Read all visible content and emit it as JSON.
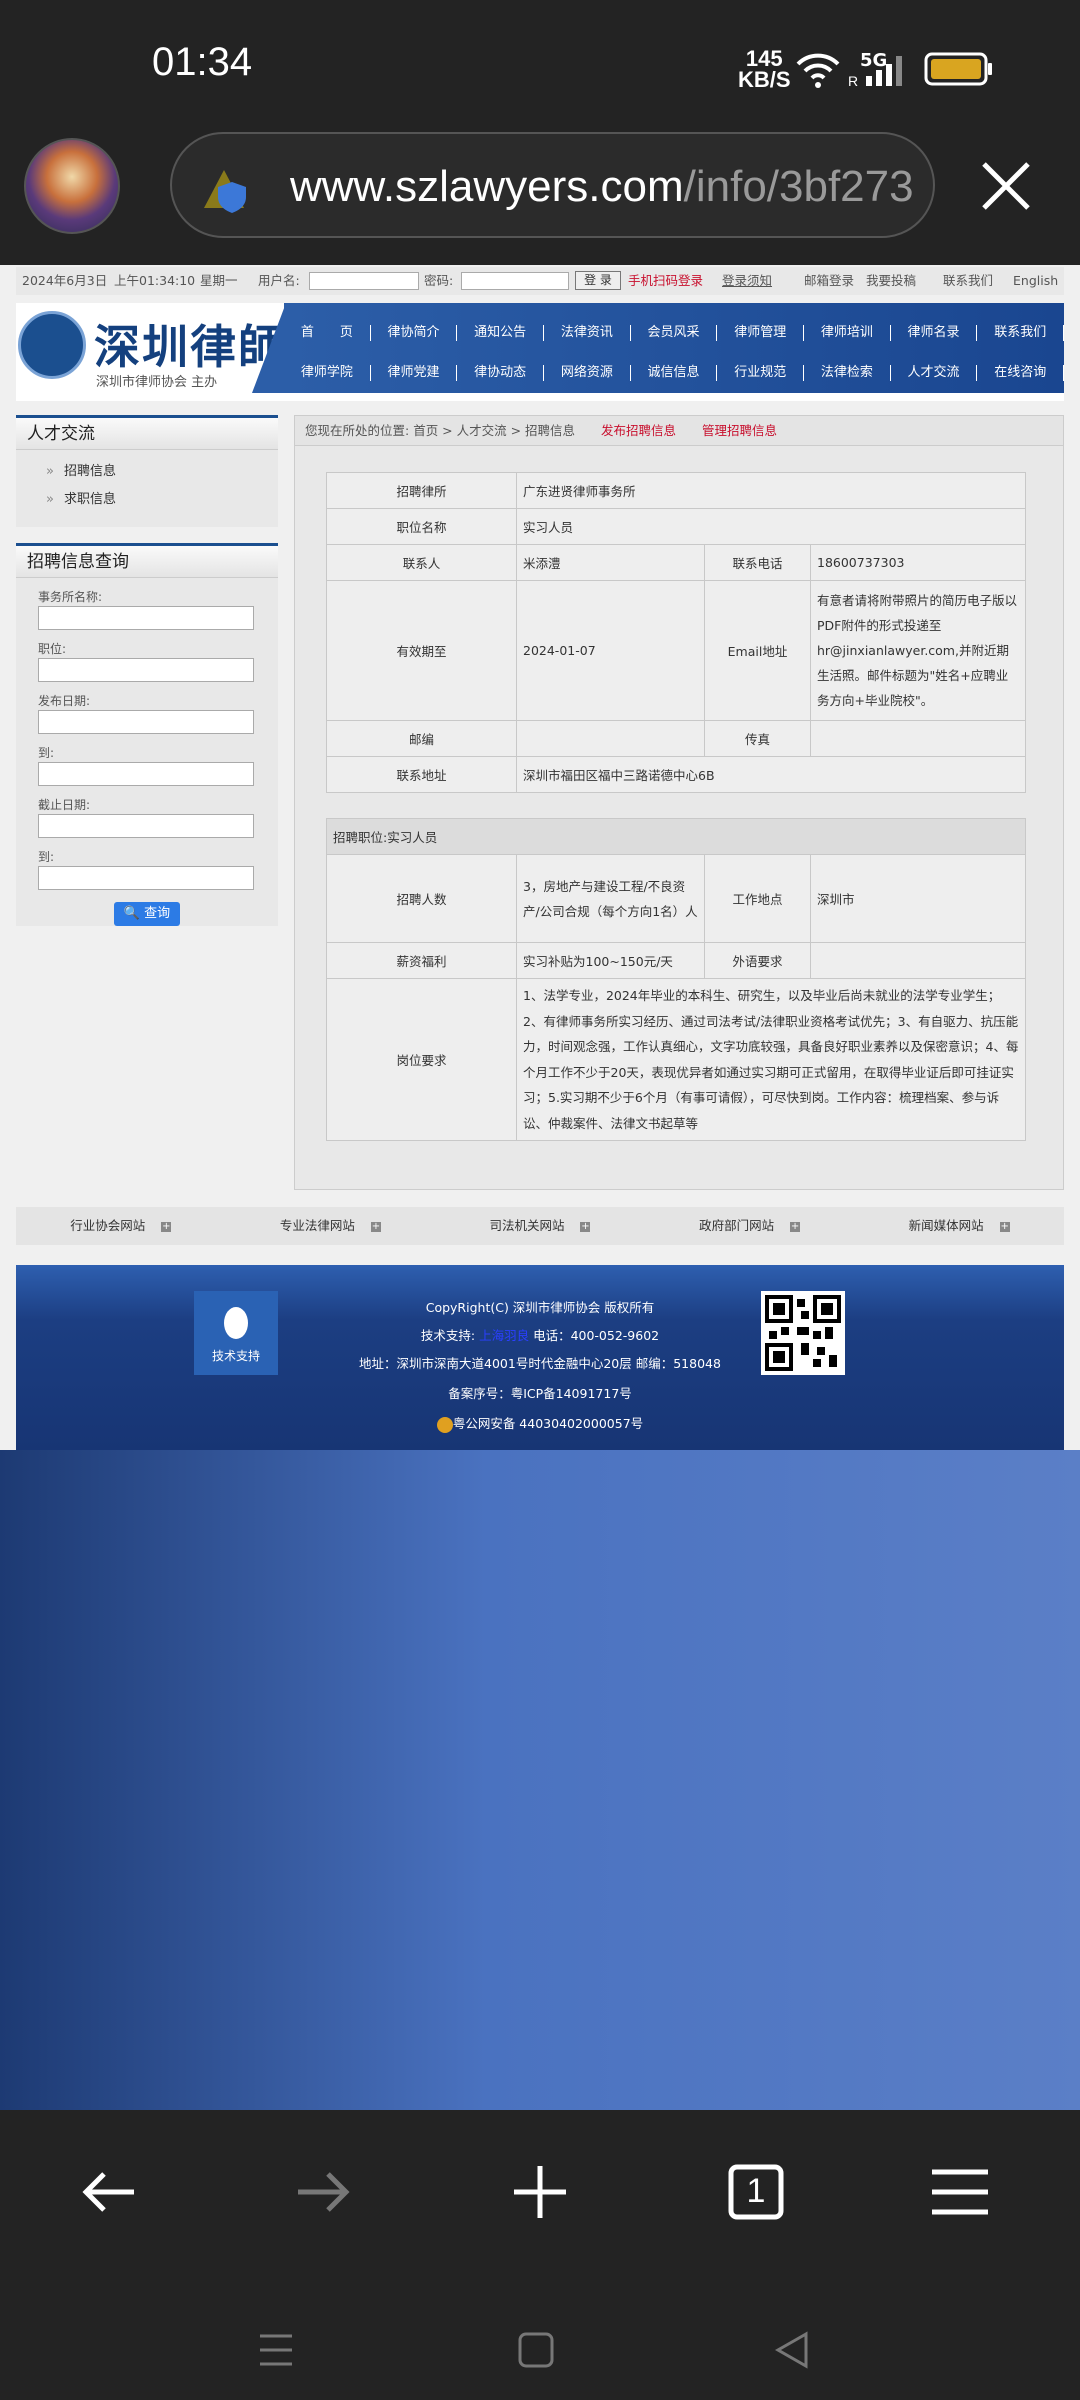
{
  "status_bar": {
    "time": "01:34",
    "net_speed_value": "145",
    "net_speed_unit": "KB/S",
    "network": "5G",
    "battery_color": "#d9a520"
  },
  "browser": {
    "url_domain": "www.szlawyers.com",
    "url_path": "/info/3bf273",
    "tab_count": "1"
  },
  "site": {
    "topbar": {
      "date": "2024年6月3日",
      "time": "上午01:34:10",
      "weekday": "星期一",
      "username_label": "用户名:",
      "password_label": "密码:",
      "login_button": "登 录",
      "qr_login": "手机扫码登录",
      "login_notice": "登录须知",
      "mail_login": "邮箱登录",
      "submit": "我要投稿",
      "contact": "联系我们",
      "english": "English"
    },
    "logo": {
      "title": "深圳律師",
      "subtitle": "深圳市律师协会 主办"
    },
    "nav_row1": [
      "首　　页",
      "律协简介",
      "通知公告",
      "法律资讯",
      "会员风采",
      "律师管理",
      "律师培训",
      "律师名录",
      "联系我们"
    ],
    "nav_row2": [
      "律师学院",
      "律师党建",
      "律协动态",
      "网络资源",
      "诚信信息",
      "行业规范",
      "法律检索",
      "人才交流",
      "在线咨询"
    ],
    "sidebar": {
      "talent_title": "人才交流",
      "talent_links": [
        "招聘信息",
        "求职信息"
      ],
      "query_title": "招聘信息查询",
      "query_fields": [
        "事务所名称:",
        "职位:",
        "发布日期:",
        "到:",
        "截止日期:",
        "到:"
      ],
      "query_button": "查询"
    },
    "breadcrumb": {
      "prefix": "您现在所处的位置:",
      "path": "首页 > 人才交流 > 招聘信息",
      "publish": "发布招聘信息",
      "manage": "管理招聘信息"
    },
    "info": {
      "firm_label": "招聘律所",
      "firm_value": "广东进贤律师事务所",
      "position_label": "职位名称",
      "position_value": "实习人员",
      "contact_label": "联系人",
      "contact_value": "米添澧",
      "phone_label": "联系电话",
      "phone_value": "18600737303",
      "expiry_label": "有效期至",
      "expiry_value": "2024-01-07",
      "email_label": "Email地址",
      "email_value": "有意者请将附带照片的简历电子版以PDF附件的形式投递至hr@jinxianlawyer.com,并附近期生活照。邮件标题为\"姓名+应聘业务方向+毕业院校\"。",
      "zip_label": "邮编",
      "zip_value": "",
      "fax_label": "传真",
      "fax_value": "",
      "address_label": "联系地址",
      "address_value": "深圳市福田区福中三路诺德中心6B"
    },
    "position": {
      "header": "招聘职位:实习人员",
      "count_label": "招聘人数",
      "count_value": "3，房地产与建设工程/不良资产/公司合规（每个方向1名）人",
      "location_label": "工作地点",
      "location_value": "深圳市",
      "salary_label": "薪资福利",
      "salary_value": "实习补贴为100~150元/天",
      "language_label": "外语要求",
      "language_value": "",
      "req_label": "岗位要求",
      "req_value": "1、法学专业，2024年毕业的本科生、研究生，以及毕业后尚未就业的法学专业学生；2、有律师事务所实习经历、通过司法考试/法律职业资格考试优先；3、有自驱力、抗压能力，时间观念强，工作认真细心，文字功底较强，具备良好职业素养以及保密意识；4、每个月工作不少于20天，表现优异者如通过实习期可正式留用，在取得毕业证后即可挂证实习；5.实习期不少于6个月（有事可请假），可尽快到岗。工作内容：梳理档案、参与诉讼、仲裁案件、法律文书起草等"
    },
    "footer_links": [
      "行业协会网站",
      "专业法律网站",
      "司法机关网站",
      "政府部门网站",
      "新闻媒体网站"
    ],
    "copyright": {
      "line1": "CopyRight(C) 深圳市律师协会 版权所有",
      "tech_label": "技术支持:",
      "tech_company": "上海羽良",
      "phone": "电话：400-052-9602",
      "address": "地址：深圳市深南大道4001号时代金融中心20层 邮编：518048",
      "icp": "备案序号：粤ICP备14091717号",
      "police": "粤公网安备 44030402000057号",
      "tech_box": "技术支持"
    }
  }
}
